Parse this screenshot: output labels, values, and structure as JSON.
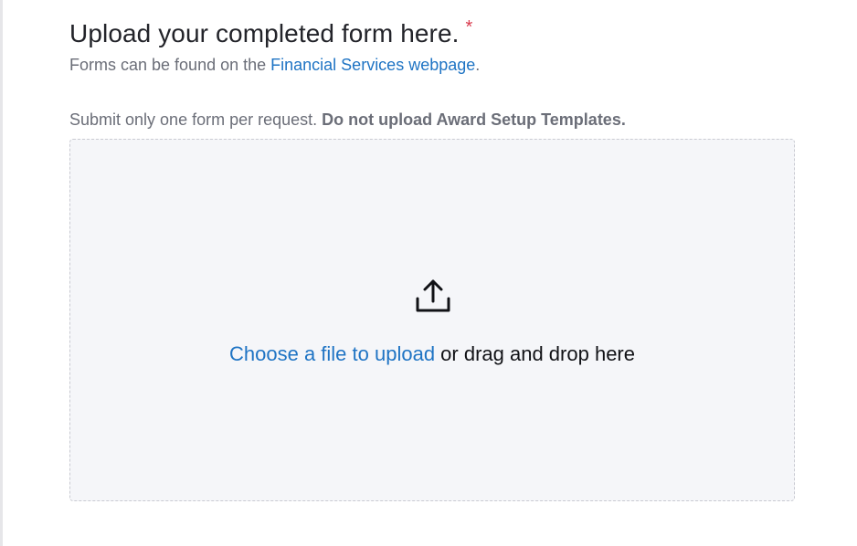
{
  "form": {
    "title": "Upload your completed form here.",
    "required_marker": "*",
    "subtitle_prefix": "Forms can be found on the ",
    "subtitle_link": "Financial Services webpage",
    "subtitle_suffix": ".",
    "note_text": "Submit only one form per request. ",
    "note_bold": "Do not upload Award Setup Templates."
  },
  "dropzone": {
    "icon": "upload-icon",
    "choose_link": "Choose a file to upload",
    "drag_text": " or drag and drop here"
  },
  "colors": {
    "link": "#1f74c4",
    "required": "#d93a4d",
    "dropzone_bg": "#f5f6f9"
  }
}
